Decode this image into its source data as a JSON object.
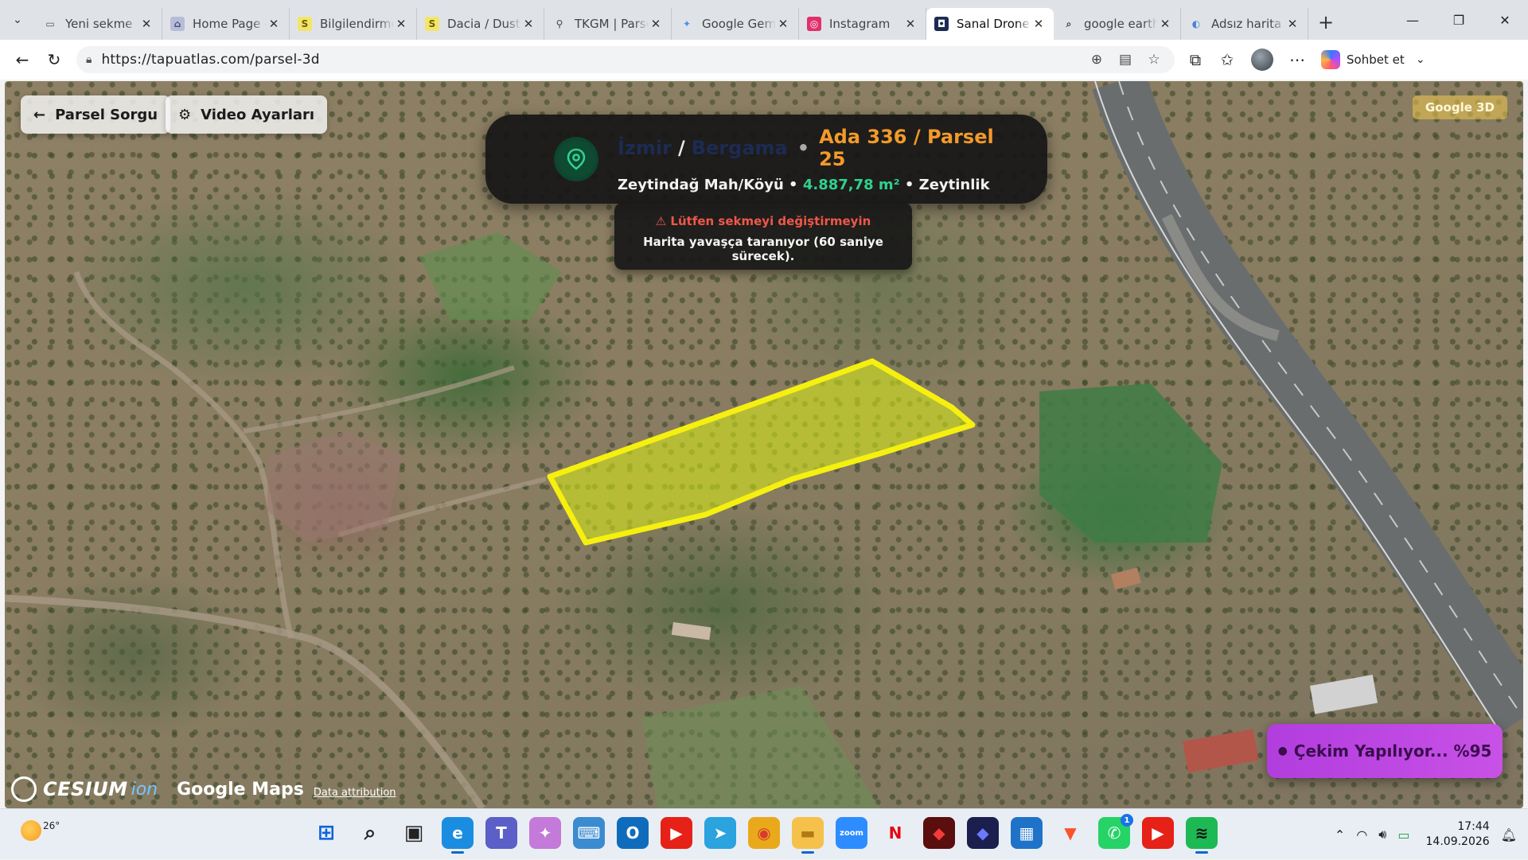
{
  "browser": {
    "tabs": [
      {
        "title": "Yeni sekme",
        "icon": "new-tab-page-icon",
        "icon_char": "▭",
        "icon_bg": "#dfe3e8",
        "icon_fg": "#555",
        "active": false
      },
      {
        "title": "Home Page - ",
        "icon": "home-page-icon",
        "icon_char": "⌂",
        "icon_bg": "#b7bdd6",
        "icon_fg": "#3b4a8a",
        "active": false
      },
      {
        "title": "Bilgilendirme",
        "icon": "s-site-icon",
        "icon_char": "S",
        "icon_bg": "#f2e56b",
        "icon_fg": "#6b5d00",
        "active": false
      },
      {
        "title": "Dacia / Duste",
        "icon": "s-site-icon",
        "icon_char": "S",
        "icon_bg": "#f2e56b",
        "icon_fg": "#6b5d00",
        "active": false
      },
      {
        "title": "TKGM | Parse",
        "icon": "map-pin-icon",
        "icon_char": "⚲",
        "icon_bg": "transparent",
        "icon_fg": "#444",
        "active": false
      },
      {
        "title": "Google Gemi",
        "icon": "gemini-icon",
        "icon_char": "✦",
        "icon_bg": "transparent",
        "icon_fg": "#4c8df6",
        "active": false
      },
      {
        "title": "Instagram",
        "icon": "instagram-icon",
        "icon_char": "◎",
        "icon_bg": "#e1306c",
        "icon_fg": "#fff",
        "active": false
      },
      {
        "title": "Sanal Drone -",
        "icon": "sanal-drone-icon",
        "icon_char": "◘",
        "icon_bg": "#1c2b52",
        "icon_fg": "#fff",
        "active": true
      },
      {
        "title": "google earth",
        "icon": "search-icon",
        "icon_char": "⌕",
        "icon_bg": "transparent",
        "icon_fg": "#444",
        "active": false
      },
      {
        "title": "Adsız harita",
        "icon": "earth-icon",
        "icon_char": "◐",
        "icon_bg": "transparent",
        "icon_fg": "#4a7fd6",
        "active": false
      }
    ],
    "url": "https://tapuatlas.com/parsel-3d",
    "copilot_label": "Sohbet et"
  },
  "map": {
    "back_button": "Parsel Sorgu",
    "video_settings_button": "Video Ayarları",
    "badge": "Google 3D",
    "info": {
      "city": "İzmir",
      "separator": "/",
      "district": "Bergama",
      "bullet": "•",
      "parcel": "Ada 336 / Parsel 25",
      "neighborhood": "Zeytindağ Mah/Köyü",
      "dot": "•",
      "area": "4.887,78 m²",
      "land_use": "Zeytinlik"
    },
    "toast": {
      "warning": "Lütfen sekmeyi değiştirmeyin",
      "message": "Harita yavaşça taranıyor (60 saniye sürecek)."
    },
    "recording": {
      "label": "Çekim Yapılıyor... %95",
      "progress_percent": 95
    },
    "attribution": {
      "cesium": "CESIUM",
      "ion": "ion",
      "google": "Google Maps",
      "data": "Data attribution"
    },
    "parcel_color": "#f5f010"
  },
  "taskbar": {
    "weather_temp": "26°",
    "apps": [
      {
        "name": "windows-start-icon",
        "char": "⊞",
        "bg": "transparent",
        "fg": "#0a64d8",
        "active": false
      },
      {
        "name": "search-icon",
        "char": "⌕",
        "bg": "transparent",
        "fg": "#222",
        "active": false
      },
      {
        "name": "task-view-icon",
        "char": "▣",
        "bg": "transparent",
        "fg": "#222",
        "active": false
      },
      {
        "name": "edge-icon",
        "char": "e",
        "bg": "#1b8de0",
        "fg": "#fff",
        "active": true
      },
      {
        "name": "teams-icon",
        "char": "T",
        "bg": "#5b5fc7",
        "fg": "#fff",
        "active": false
      },
      {
        "name": "copilot-icon",
        "char": "✦",
        "bg": "#c37ad8",
        "fg": "#fff",
        "active": false
      },
      {
        "name": "keyboard-icon",
        "char": "⌨",
        "bg": "#3b8bd0",
        "fg": "#fff",
        "active": false
      },
      {
        "name": "outlook-icon",
        "char": "O",
        "bg": "#0f6cbd",
        "fg": "#fff",
        "active": false
      },
      {
        "name": "youtube-icon",
        "char": "▶",
        "bg": "#e62117",
        "fg": "#fff",
        "active": false
      },
      {
        "name": "telegram-icon",
        "char": "➤",
        "bg": "#2aa3de",
        "fg": "#fff",
        "active": false
      },
      {
        "name": "chrome-icon",
        "char": "◉",
        "bg": "#e9a91b",
        "fg": "#d83a2e",
        "active": false
      },
      {
        "name": "file-explorer-icon",
        "char": "▬",
        "bg": "#f5c14b",
        "fg": "#b07b10",
        "active": true
      },
      {
        "name": "zoom-icon",
        "char": "zoom",
        "bg": "#2d8cff",
        "fg": "#fff",
        "active": false
      },
      {
        "name": "netflix-icon",
        "char": "N",
        "bg": "transparent",
        "fg": "#e50914",
        "active": false
      },
      {
        "name": "app-red-icon",
        "char": "◆",
        "bg": "#5a0e0e",
        "fg": "#f23b3b",
        "active": false
      },
      {
        "name": "app-blue-icon",
        "char": "◆",
        "bg": "#1a1f4e",
        "fg": "#6a7bff",
        "active": false
      },
      {
        "name": "microsoft-store-icon",
        "char": "▦",
        "bg": "#1e73c8",
        "fg": "#fff",
        "active": false
      },
      {
        "name": "brave-icon",
        "char": "▼",
        "bg": "transparent",
        "fg": "#fb542b",
        "active": false
      },
      {
        "name": "whatsapp-icon",
        "char": "✆",
        "bg": "#25d366",
        "fg": "#fff",
        "active": false,
        "badge": "1"
      },
      {
        "name": "youtube-icon-2",
        "char": "▶",
        "bg": "#e62117",
        "fg": "#fff",
        "active": false
      },
      {
        "name": "spotify-icon",
        "char": "≋",
        "bg": "#1db954",
        "fg": "#111",
        "active": true
      }
    ],
    "time": "17:44",
    "date": "14.09.2026"
  }
}
